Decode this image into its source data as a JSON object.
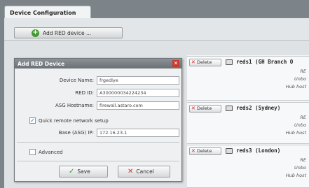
{
  "window": {
    "tab_title": "Device Configuration"
  },
  "toolbar": {
    "add_label": "Add RED device ..."
  },
  "dialog": {
    "title": "Add RED Device",
    "fields": [
      {
        "label": "Device Name:",
        "value": "frgedlye"
      },
      {
        "label": "RED ID:",
        "value": "A300000034224234"
      },
      {
        "label": "ASG Hostname:",
        "value": "firewall.astaro.com"
      }
    ],
    "quick_setup": {
      "label": "Quick remote network setup",
      "checked": true
    },
    "base_ip": {
      "label": "Base (ASG) IP:",
      "value": "172.16.23.1"
    },
    "advanced": {
      "label": "Advanced",
      "checked": false
    },
    "save_label": "Save",
    "cancel_label": "Cancel"
  },
  "devices": [
    {
      "delete_label": "Delete",
      "name": "reds1 (GH Branch O",
      "meta": [
        "RE",
        "Unbo",
        "Hub host"
      ]
    },
    {
      "delete_label": "Delete",
      "name": "reds2 (Sydney)",
      "meta": [
        "RE",
        "Unbo",
        "Hub host"
      ]
    },
    {
      "delete_label": "Delete",
      "name": "reds3 (London)",
      "meta": [
        "RE",
        "Unbo",
        "Hub host"
      ]
    }
  ],
  "colors": {
    "accent_green": "#3f9a2f",
    "danger_red": "#c93a2e",
    "title_bar": "#6a7075"
  },
  "icons": {
    "add": "plus-circle-icon",
    "close": "close-icon",
    "save": "check-icon",
    "cancel": "x-icon",
    "device": "device-icon"
  }
}
